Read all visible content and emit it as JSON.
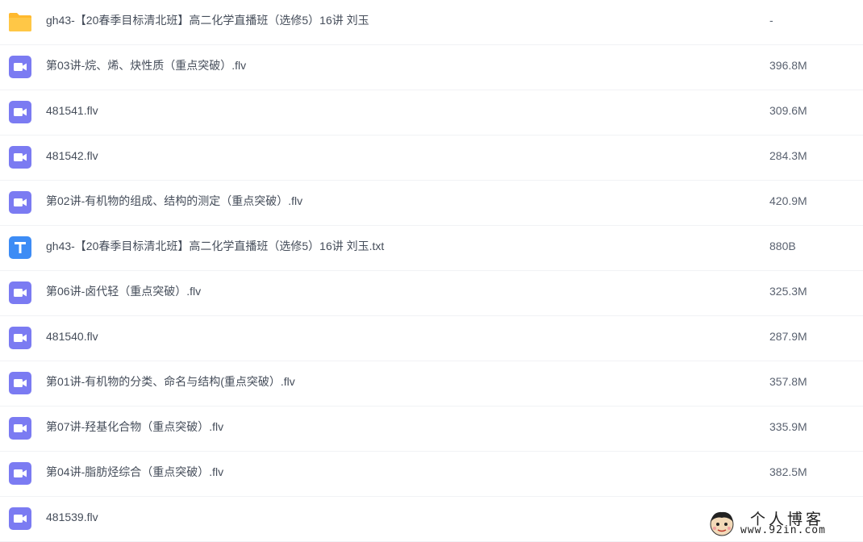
{
  "files": [
    {
      "type": "folder",
      "icon": "folder-icon",
      "name": "gh43-【20春季目标清北班】高二化学直播班（选修5）16讲 刘玉",
      "size": "-"
    },
    {
      "type": "video",
      "icon": "video-file-icon",
      "name": "第03讲-烷、烯、炔性质（重点突破）.flv",
      "size": "396.8M"
    },
    {
      "type": "video",
      "icon": "video-file-icon",
      "name": "481541.flv",
      "size": "309.6M"
    },
    {
      "type": "video",
      "icon": "video-file-icon",
      "name": "481542.flv",
      "size": "284.3M"
    },
    {
      "type": "video",
      "icon": "video-file-icon",
      "name": "第02讲-有机物的组成、结构的测定（重点突破）.flv",
      "size": "420.9M"
    },
    {
      "type": "text",
      "icon": "text-file-icon",
      "name": "gh43-【20春季目标清北班】高二化学直播班（选修5）16讲 刘玉.txt",
      "size": "880B"
    },
    {
      "type": "video",
      "icon": "video-file-icon",
      "name": "第06讲-卤代轻（重点突破）.flv",
      "size": "325.3M"
    },
    {
      "type": "video",
      "icon": "video-file-icon",
      "name": "481540.flv",
      "size": "287.9M"
    },
    {
      "type": "video",
      "icon": "video-file-icon",
      "name": "第01讲-有机物的分类、命名与结构(重点突破）.flv",
      "size": "357.8M"
    },
    {
      "type": "video",
      "icon": "video-file-icon",
      "name": "第07讲-羟基化合物（重点突破）.flv",
      "size": "335.9M"
    },
    {
      "type": "video",
      "icon": "video-file-icon",
      "name": "第04讲-脂肪烃综合（重点突破）.flv",
      "size": "382.5M"
    },
    {
      "type": "video",
      "icon": "video-file-icon",
      "name": "481539.flv",
      "size": ""
    }
  ],
  "watermark": {
    "title": "个人博客",
    "url": "www.92in.com"
  },
  "colors": {
    "folder": "#ffc746",
    "video": "#7b7bf2",
    "text": "#3d8cf5"
  }
}
